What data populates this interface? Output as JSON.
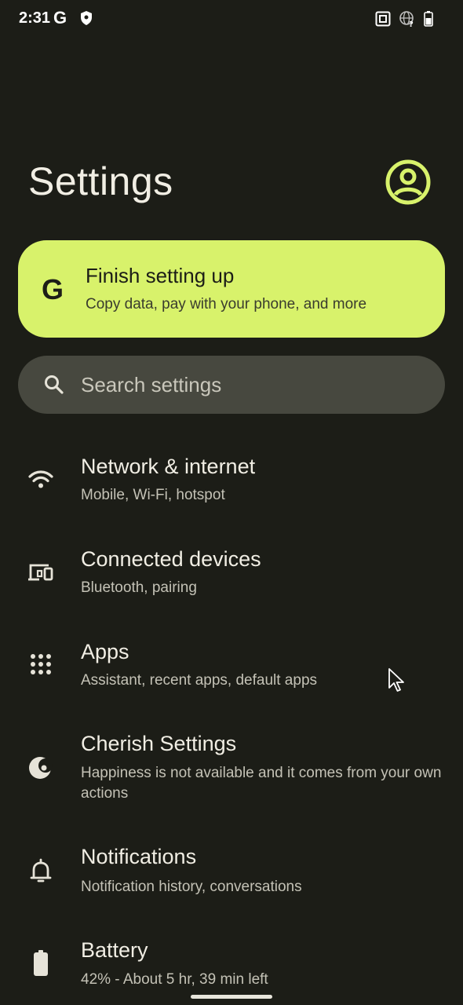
{
  "status_bar": {
    "time": "2:31",
    "g_letter": "G"
  },
  "header": {
    "title": "Settings"
  },
  "setup_card": {
    "icon_letter": "G",
    "title": "Finish setting up",
    "subtitle": "Copy data, pay with your phone, and more"
  },
  "search": {
    "placeholder": "Search settings"
  },
  "items": [
    {
      "icon": "wifi-icon",
      "title": "Network & internet",
      "subtitle": "Mobile, Wi-Fi, hotspot"
    },
    {
      "icon": "devices-icon",
      "title": "Connected devices",
      "subtitle": "Bluetooth, pairing"
    },
    {
      "icon": "apps-grid-icon",
      "title": "Apps",
      "subtitle": "Assistant, recent apps, default apps"
    },
    {
      "icon": "moon-icon",
      "title": "Cherish Settings",
      "subtitle": "Happiness is not available and it comes from your own actions"
    },
    {
      "icon": "bell-icon",
      "title": "Notifications",
      "subtitle": "Notification history, conversations"
    },
    {
      "icon": "battery-icon",
      "title": "Battery",
      "subtitle": "42% - About 5 hr, 39 min left"
    }
  ],
  "colors": {
    "background": "#1c1d17",
    "accent": "#d8f26b",
    "search_bg": "#47483f"
  }
}
